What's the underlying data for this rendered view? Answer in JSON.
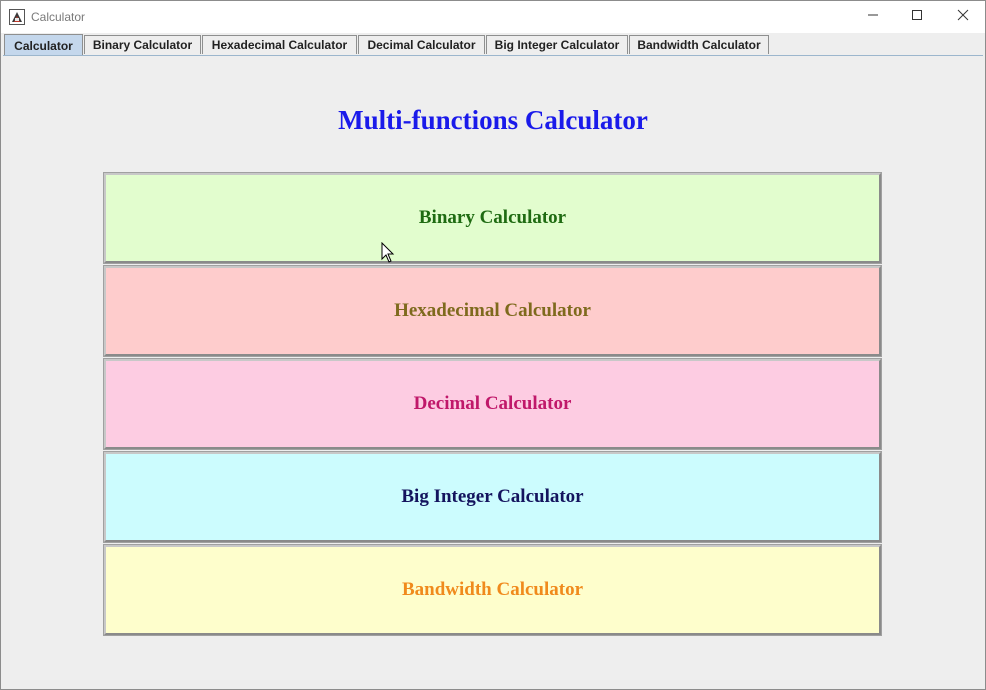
{
  "window": {
    "title": "Calculator",
    "app_icon": "java-app-icon"
  },
  "tabs": [
    {
      "label": "Calculator",
      "active": true
    },
    {
      "label": "Binary Calculator",
      "active": false
    },
    {
      "label": "Hexadecimal Calculator",
      "active": false
    },
    {
      "label": "Decimal Calculator",
      "active": false
    },
    {
      "label": "Big Integer Calculator",
      "active": false
    },
    {
      "label": "Bandwidth Calculator",
      "active": false
    }
  ],
  "main": {
    "heading": "Multi-functions Calculator",
    "heading_color": "#1a1aea",
    "buttons": [
      {
        "label": "Binary Calculator",
        "bg": "#e2fdce",
        "fg": "#1f6b12"
      },
      {
        "label": "Hexadecimal Calculator",
        "bg": "#fecccc",
        "fg": "#7e6a1d"
      },
      {
        "label": "Decimal Calculator",
        "bg": "#fdcce2",
        "fg": "#c0186a"
      },
      {
        "label": "Big Integer Calculator",
        "bg": "#ccfcfe",
        "fg": "#14145e"
      },
      {
        "label": "Bandwidth Calculator",
        "bg": "#fefecc",
        "fg": "#f08a1c"
      }
    ]
  },
  "icons": {
    "minimize": "minimize-icon",
    "maximize": "maximize-icon",
    "close": "close-icon",
    "cursor": "mouse-pointer-icon"
  }
}
